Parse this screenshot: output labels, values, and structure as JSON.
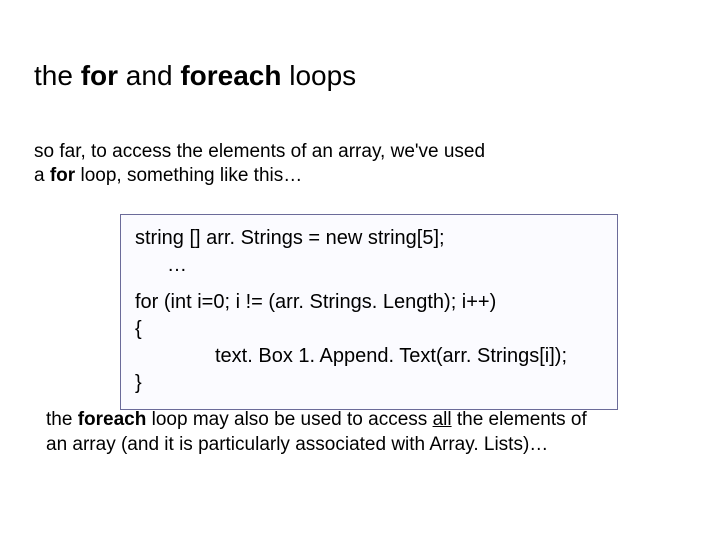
{
  "title": {
    "t1": "the ",
    "t2": "for",
    "t3": " and ",
    "t4": "foreach",
    "t5": " loops"
  },
  "intro": {
    "l1a": "so far, to access the elements of an array, we've used",
    "l2a": "a ",
    "l2b": "for",
    "l2c": " loop, something like this…"
  },
  "code": {
    "l1": "string [] arr. Strings = new string[5];",
    "l2": "…",
    "l3": "for (int i=0; i != (arr. Strings. Length); i++)",
    "l4": "{",
    "l5": "text. Box 1. Append. Text(arr. Strings[i]);",
    "l6": "}"
  },
  "outro": {
    "o1": "the ",
    "o2": "foreach",
    "o3": " loop may also be used to access ",
    "o4": "all",
    "o5": " the elements of",
    "o6": "an  array (and it is particularly associated with Array. Lists)…"
  }
}
